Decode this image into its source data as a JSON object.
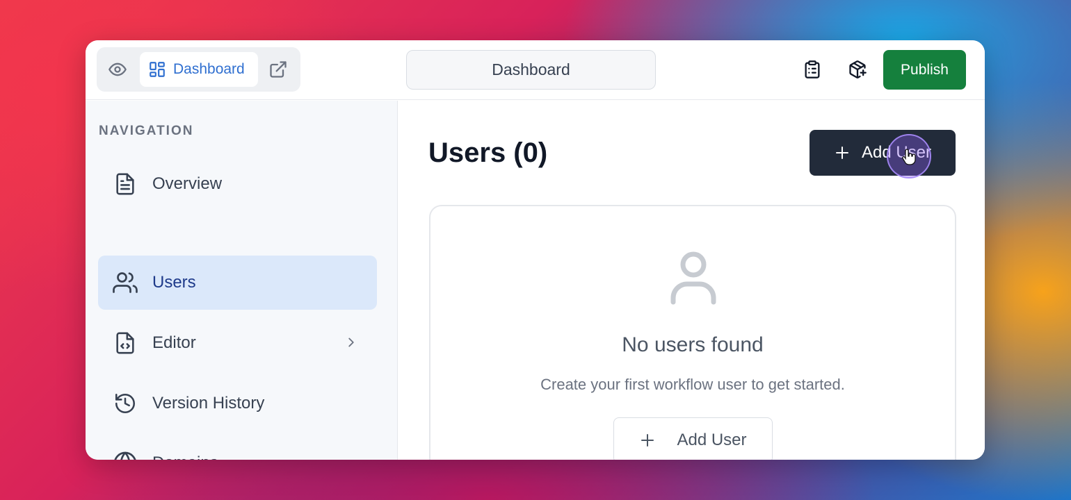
{
  "topbar": {
    "segmented": {
      "preview_icon": "eye-icon",
      "active_icon": "layout-grid-icon",
      "active_label": "Dashboard",
      "external_icon": "external-link-icon"
    },
    "page_name": "Dashboard",
    "icons": [
      "clipboard-list-icon",
      "package-plus-icon"
    ],
    "publish_label": "Publish",
    "publish_color": "#15803d"
  },
  "sidebar": {
    "heading": "NAVIGATION",
    "items": [
      {
        "label": "Overview",
        "icon": "file-text-icon",
        "active": false
      },
      {
        "label": "Users",
        "icon": "users-icon",
        "active": true
      },
      {
        "label": "Editor",
        "icon": "file-code-icon",
        "active": false,
        "has_chevron": true
      },
      {
        "label": "Version History",
        "icon": "history-icon",
        "active": false
      },
      {
        "label": "Domains",
        "icon": "globe-icon",
        "active": false
      }
    ]
  },
  "main": {
    "title": "Users (0)",
    "add_button_label": "Add User",
    "empty_state": {
      "icon": "user-icon",
      "title": "No users found",
      "message": "Create your first workflow user to get started.",
      "button_label": "Add User"
    }
  },
  "colors": {
    "accent": "#2f6fd0",
    "active_nav_bg": "#dbe8fa",
    "dark_button": "#222b3a"
  }
}
